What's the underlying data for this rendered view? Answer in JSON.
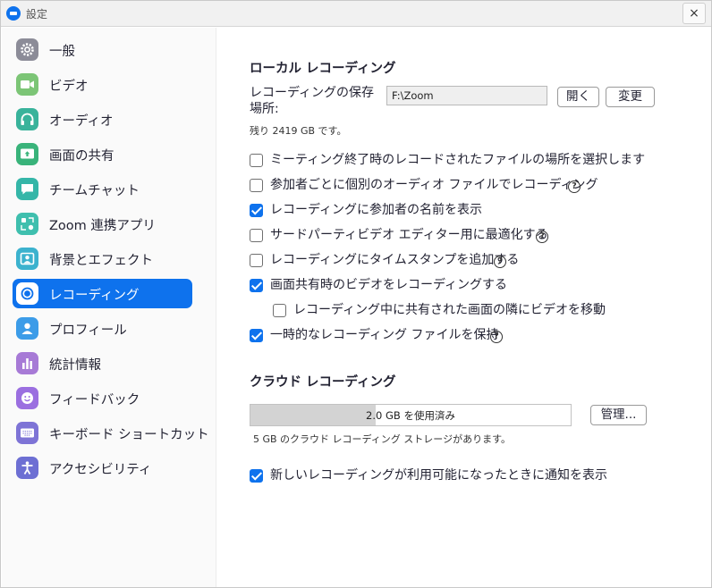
{
  "window": {
    "title": "設定",
    "close_label": "×"
  },
  "sidebar": {
    "items": [
      {
        "label": "一般",
        "icon": "gear-icon",
        "color": "#8c8c98",
        "active": false
      },
      {
        "label": "ビデオ",
        "icon": "video-icon",
        "color": "#7cc576",
        "active": false
      },
      {
        "label": "オーディオ",
        "icon": "headphones-icon",
        "color": "#39b39b",
        "active": false
      },
      {
        "label": "画面の共有",
        "icon": "share-screen-icon",
        "color": "#39b37a",
        "active": false
      },
      {
        "label": "チームチャット",
        "icon": "chat-icon",
        "color": "#35b6a8",
        "active": false
      },
      {
        "label": "Zoom 連携アプリ",
        "icon": "apps-icon",
        "color": "#3fbfae",
        "active": false
      },
      {
        "label": "背景とエフェクト",
        "icon": "background-icon",
        "color": "#3cb2ce",
        "active": false
      },
      {
        "label": "レコーディング",
        "icon": "record-icon",
        "color": "#ffffff",
        "active": true
      },
      {
        "label": "プロフィール",
        "icon": "profile-icon",
        "color": "#3c9ce8",
        "active": false
      },
      {
        "label": "統計情報",
        "icon": "statistics-icon",
        "color": "#a77ad6",
        "active": false
      },
      {
        "label": "フィードバック",
        "icon": "feedback-icon",
        "color": "#9b6fe0",
        "active": false
      },
      {
        "label": "キーボード ショートカット",
        "icon": "keyboard-icon",
        "color": "#7e74d6",
        "active": false
      },
      {
        "label": "アクセシビリティ",
        "icon": "accessibility-icon",
        "color": "#6d6fd3",
        "active": false
      }
    ]
  },
  "local": {
    "title": "ローカル レコーディング",
    "location_label": "レコーディングの保存場所:",
    "path_value": "F:\\Zoom",
    "open_button": "開く",
    "change_button": "変更",
    "remaining": "残り 2419 GB です。",
    "options": [
      {
        "label": "ミーティング終了時のレコードされたファイルの場所を選択します",
        "checked": false,
        "help": false,
        "indent": false
      },
      {
        "label": "参加者ごとに個別のオーディオ ファイルでレコーディング",
        "checked": false,
        "help": true,
        "indent": false
      },
      {
        "label": "レコーディングに参加者の名前を表示",
        "checked": true,
        "help": false,
        "indent": false
      },
      {
        "label": "サードパーティビデオ エディター用に最適化する",
        "checked": false,
        "help": true,
        "indent": false
      },
      {
        "label": "レコーディングにタイムスタンプを追加する",
        "checked": false,
        "help": true,
        "indent": false
      },
      {
        "label": "画面共有時のビデオをレコーディングする",
        "checked": true,
        "help": false,
        "indent": false
      },
      {
        "label": "レコーディング中に共有された画面の隣にビデオを移動",
        "checked": false,
        "help": false,
        "indent": true
      },
      {
        "label": "一時的なレコーディング ファイルを保持",
        "checked": true,
        "help": true,
        "indent": false
      }
    ]
  },
  "cloud": {
    "title": "クラウド レコーディング",
    "usage_text": "2.0 GB を使用済み",
    "usage_fraction": 0.39,
    "manage_button": "管理...",
    "quota_text": "5 GB のクラウド レコーディング ストレージがあります。",
    "notify_label": "新しいレコーディングが利用可能になったときに通知を表示",
    "notify_checked": true
  },
  "help_glyph": "?"
}
